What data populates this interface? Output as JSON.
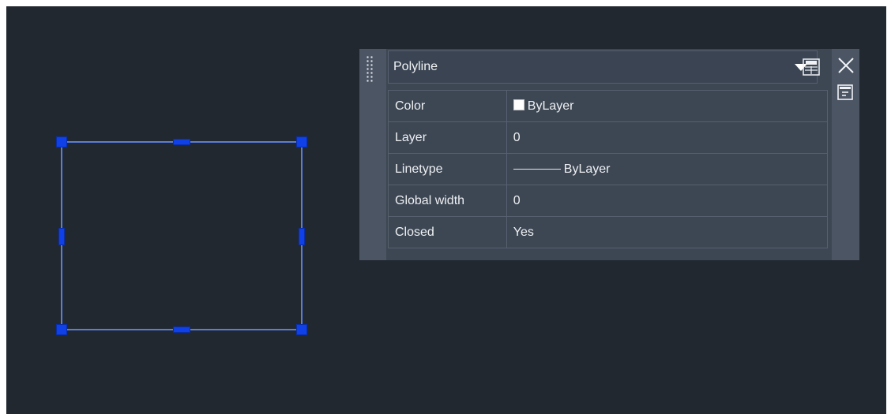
{
  "quick_properties": {
    "object_type": "Polyline",
    "rows": [
      {
        "label": "Color",
        "value": "ByLayer",
        "swatch_color": "#ffffff"
      },
      {
        "label": "Layer",
        "value": "0"
      },
      {
        "label": "Linetype",
        "value": "ByLayer"
      },
      {
        "label": "Global width",
        "value": "0"
      },
      {
        "label": "Closed",
        "value": "Yes"
      }
    ],
    "buttons": {
      "dropdown_icon": "chevron-down-icon",
      "cui_icon": "cui-icon",
      "close_icon": "close-icon",
      "collapse_icon": "collapse-icon"
    }
  },
  "colors": {
    "canvas": "#212830",
    "polyline": "#5b7dd8",
    "grip": "#1040e8",
    "panel": "#3d4754"
  }
}
